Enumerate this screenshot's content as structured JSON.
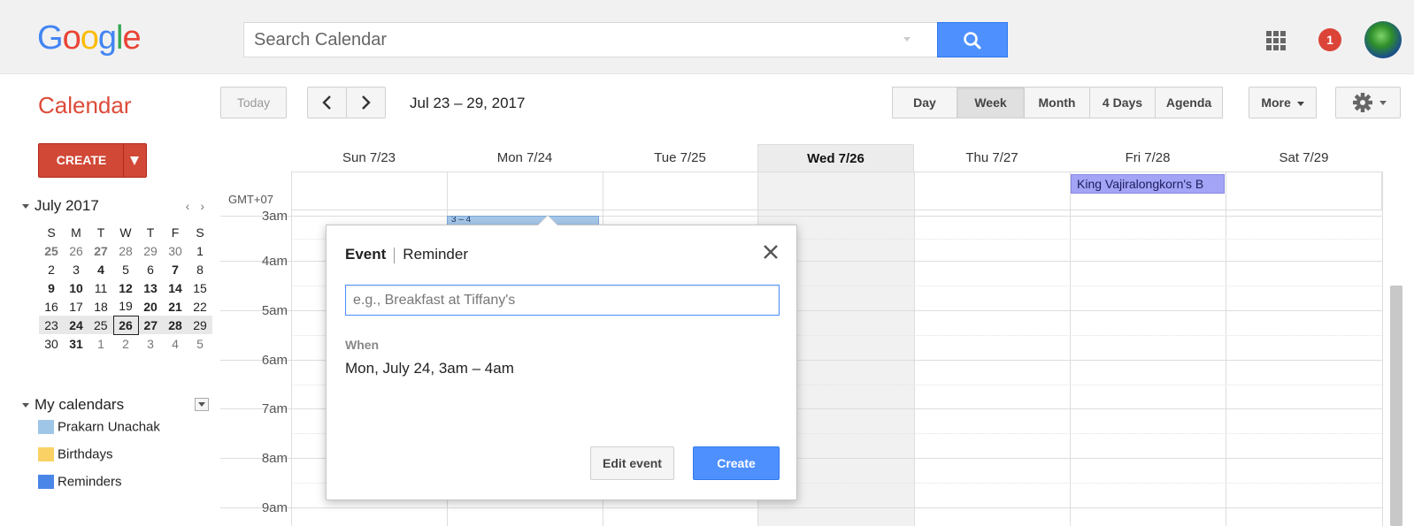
{
  "header": {
    "logo_letters": [
      {
        "ch": "G",
        "color": "#4285f4"
      },
      {
        "ch": "o",
        "color": "#ea4335"
      },
      {
        "ch": "o",
        "color": "#fbbc05"
      },
      {
        "ch": "g",
        "color": "#4285f4"
      },
      {
        "ch": "l",
        "color": "#34a853"
      },
      {
        "ch": "e",
        "color": "#ea4335"
      }
    ],
    "search_placeholder": "Search Calendar",
    "notification_count": "1"
  },
  "toolbar": {
    "app_title": "Calendar",
    "today_label": "Today",
    "date_range": "Jul 23 – 29, 2017",
    "views": [
      {
        "label": "Day",
        "active": false
      },
      {
        "label": "Week",
        "active": true
      },
      {
        "label": "Month",
        "active": false
      },
      {
        "label": "4 Days",
        "active": false
      },
      {
        "label": "Agenda",
        "active": false
      }
    ],
    "more_label": "More"
  },
  "sidebar": {
    "create_label": "CREATE",
    "mini_calendar": {
      "title": "July 2017",
      "weekdays": [
        "S",
        "M",
        "T",
        "W",
        "T",
        "F",
        "S"
      ],
      "weeks": [
        [
          {
            "d": "25",
            "s": "dim bold"
          },
          {
            "d": "26",
            "s": "dim"
          },
          {
            "d": "27",
            "s": "dim bold"
          },
          {
            "d": "28",
            "s": "dim"
          },
          {
            "d": "29",
            "s": "dim"
          },
          {
            "d": "30",
            "s": "dim"
          },
          {
            "d": "1",
            "s": ""
          }
        ],
        [
          {
            "d": "2",
            "s": ""
          },
          {
            "d": "3",
            "s": ""
          },
          {
            "d": "4",
            "s": "bold"
          },
          {
            "d": "5",
            "s": ""
          },
          {
            "d": "6",
            "s": ""
          },
          {
            "d": "7",
            "s": "bold"
          },
          {
            "d": "8",
            "s": ""
          }
        ],
        [
          {
            "d": "9",
            "s": "bold"
          },
          {
            "d": "10",
            "s": "bold"
          },
          {
            "d": "11",
            "s": ""
          },
          {
            "d": "12",
            "s": "bold"
          },
          {
            "d": "13",
            "s": "bold"
          },
          {
            "d": "14",
            "s": "bold"
          },
          {
            "d": "15",
            "s": ""
          }
        ],
        [
          {
            "d": "16",
            "s": ""
          },
          {
            "d": "17",
            "s": ""
          },
          {
            "d": "18",
            "s": ""
          },
          {
            "d": "19",
            "s": ""
          },
          {
            "d": "20",
            "s": "bold"
          },
          {
            "d": "21",
            "s": "bold"
          },
          {
            "d": "22",
            "s": ""
          }
        ],
        [
          {
            "d": "23",
            "s": ""
          },
          {
            "d": "24",
            "s": "bold"
          },
          {
            "d": "25",
            "s": ""
          },
          {
            "d": "26",
            "s": "today"
          },
          {
            "d": "27",
            "s": "bold"
          },
          {
            "d": "28",
            "s": "bold"
          },
          {
            "d": "29",
            "s": ""
          }
        ],
        [
          {
            "d": "30",
            "s": ""
          },
          {
            "d": "31",
            "s": "bold"
          },
          {
            "d": "1",
            "s": "dim"
          },
          {
            "d": "2",
            "s": "dim"
          },
          {
            "d": "3",
            "s": "dim"
          },
          {
            "d": "4",
            "s": "dim"
          },
          {
            "d": "5",
            "s": "dim"
          }
        ]
      ],
      "highlight_week": 4
    },
    "my_calendars_title": "My calendars",
    "calendars": [
      {
        "name": "Prakarn Unachak",
        "color": "#9fc6e7"
      },
      {
        "name": "Birthdays",
        "color": "#fad165"
      },
      {
        "name": "Reminders",
        "color": "#4986e7"
      }
    ]
  },
  "grid": {
    "timezone": "GMT+07",
    "days": [
      {
        "label": "Sun 7/23",
        "today": false
      },
      {
        "label": "Mon 7/24",
        "today": false
      },
      {
        "label": "Tue 7/25",
        "today": false
      },
      {
        "label": "Wed 7/26",
        "today": true
      },
      {
        "label": "Thu 7/27",
        "today": false
      },
      {
        "label": "Fri 7/28",
        "today": false
      },
      {
        "label": "Sat 7/29",
        "today": false
      }
    ],
    "hours": [
      "3am",
      "4am",
      "5am",
      "6am",
      "7am",
      "8am",
      "9am"
    ],
    "allday_event": "King Vajiralongkorn's B",
    "draft_event": "3 – 4"
  },
  "popup": {
    "tab_event": "Event",
    "tab_reminder": "Reminder",
    "title_placeholder": "e.g., Breakfast at Tiffany's",
    "when_label": "When",
    "when_value": "Mon, July 24, 3am – 4am",
    "edit_label": "Edit event",
    "create_label": "Create"
  }
}
